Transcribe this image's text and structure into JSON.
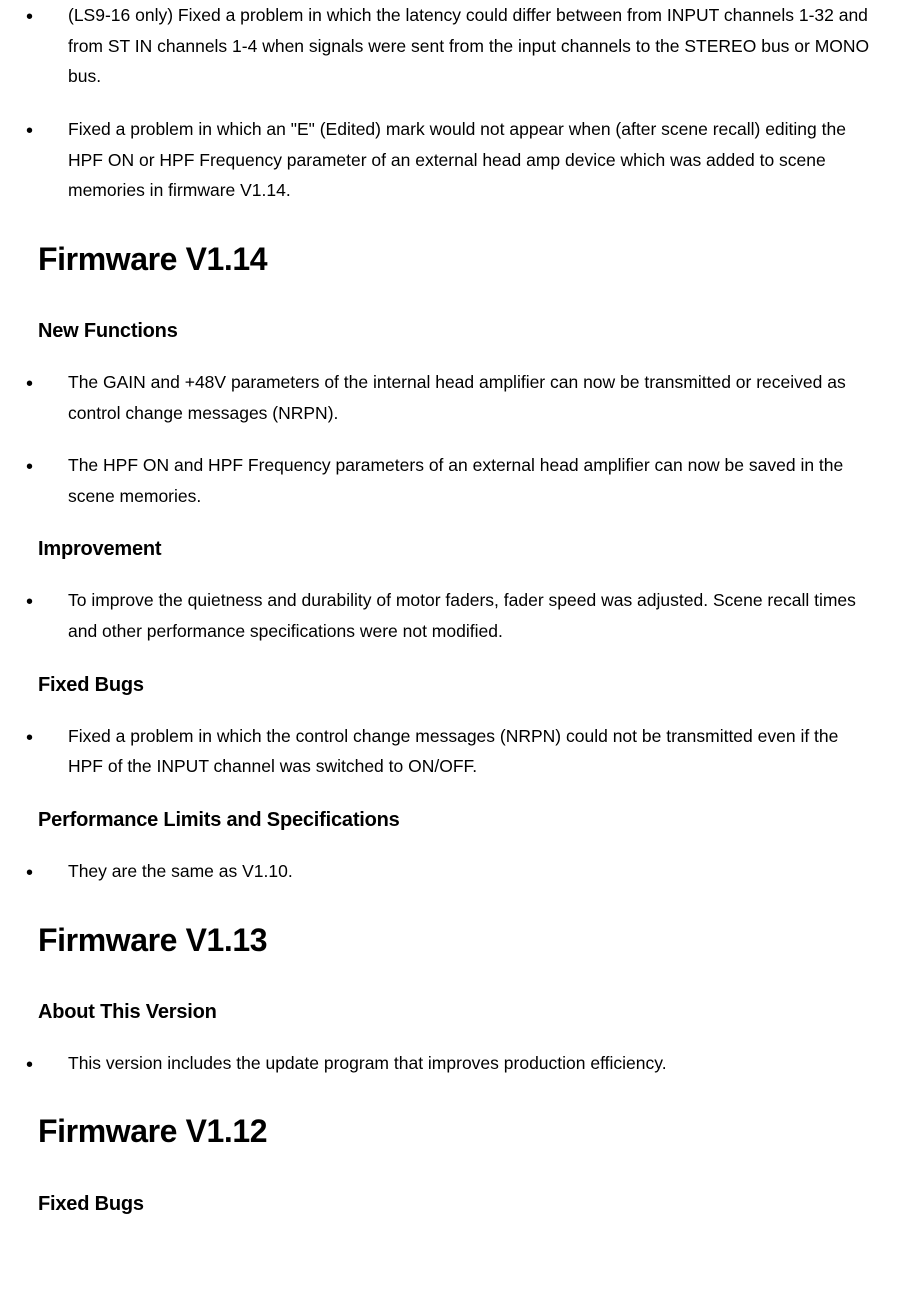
{
  "sections": [
    {
      "items": [
        "(LS9-16 only) Fixed a problem in which the latency could differ between from INPUT channels 1-32 and from ST IN channels 1-4 when signals were sent from the input channels to the STEREO bus or MONO bus.",
        "Fixed a problem in which an \"E\" (Edited) mark would not appear when (after scene recall) editing the HPF ON or HPF Frequency parameter of an external head amp device which was added to scene memories in firmware V1.14."
      ]
    }
  ],
  "v114": {
    "title": "Firmware V1.14",
    "new_functions": {
      "heading": "New Functions",
      "items": [
        "The GAIN and +48V parameters of the internal head amplifier can now be transmitted or received as control change messages (NRPN).",
        "The HPF ON and HPF Frequency parameters of an external head amplifier can now be saved in the scene memories."
      ]
    },
    "improvement": {
      "heading": "Improvement",
      "items": [
        "To improve the quietness and durability of motor faders, fader speed was adjusted. Scene recall times and other performance specifications were not modified."
      ]
    },
    "fixed_bugs": {
      "heading": "Fixed Bugs",
      "items": [
        "Fixed a problem in which the control change messages (NRPN) could not be transmitted even if the HPF of the INPUT channel was switched to ON/OFF."
      ]
    },
    "performance": {
      "heading": "Performance Limits and Specifications",
      "items": [
        "They are the same as V1.10."
      ]
    }
  },
  "v113": {
    "title": "Firmware V1.13",
    "about": {
      "heading": "About This Version",
      "items": [
        "This version includes the update program that improves production efficiency."
      ]
    }
  },
  "v112": {
    "title": "Firmware V1.12",
    "fixed_bugs": {
      "heading": "Fixed Bugs"
    }
  }
}
